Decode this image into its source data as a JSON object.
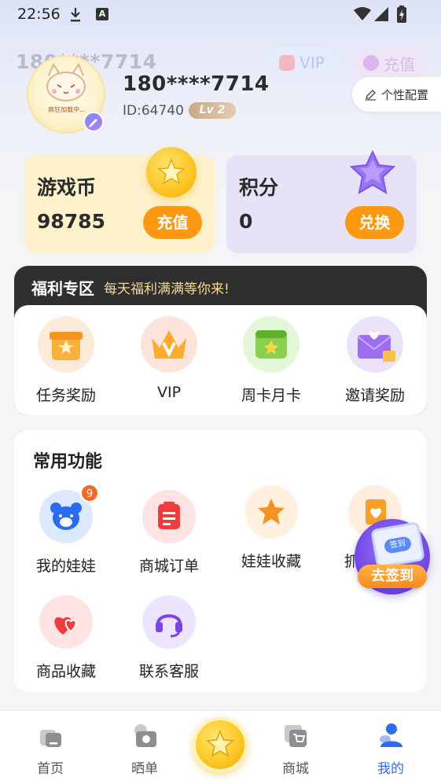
{
  "status_bar": {
    "time": "22:56"
  },
  "header": {
    "ghost_phone": "180****7714",
    "vip_label": "VIP",
    "recharge_label": "充值",
    "avatar_caption": "疯狂加载中...",
    "phone": "180****7714",
    "user_id": "ID:64740",
    "level": "Lv 2",
    "config_label": "个性配置"
  },
  "wallet": {
    "coins": {
      "title": "游戏币",
      "value": "98785",
      "button": "充值"
    },
    "points": {
      "title": "积分",
      "value": "0",
      "button": "兑换"
    }
  },
  "welfare": {
    "title": "福利专区",
    "subtitle": "每天福利满满等你来!",
    "items": [
      {
        "label": "任务奖励",
        "icon": "gift-box-icon"
      },
      {
        "label": "VIP",
        "icon": "crown-icon"
      },
      {
        "label": "周卡月卡",
        "icon": "calendar-card-icon"
      },
      {
        "label": "邀请奖励",
        "icon": "invite-envelope-icon"
      }
    ]
  },
  "common": {
    "title": "常用功能",
    "items": [
      {
        "label": "我的娃娃",
        "icon": "bear-icon",
        "badge": "9"
      },
      {
        "label": "商城订单",
        "icon": "order-icon"
      },
      {
        "label": "娃娃收藏",
        "icon": "star-icon"
      },
      {
        "label": "抓",
        "icon": "heart-card-icon"
      },
      {
        "label": "商品收藏",
        "icon": "hearts-icon"
      },
      {
        "label": "联系客服",
        "icon": "headset-icon"
      }
    ]
  },
  "floating_signin": {
    "label": "去签到",
    "calendar_text": "签到"
  },
  "bottom_nav": {
    "items": [
      {
        "label": "首页",
        "icon": "home-icon"
      },
      {
        "label": "晒单",
        "icon": "camera-icon"
      },
      {
        "label": "商城",
        "icon": "cart-icon"
      },
      {
        "label": "我的",
        "icon": "profile-icon",
        "active": true
      }
    ]
  },
  "colors": {
    "accent_orange": "#fb9a12",
    "active_blue": "#2f6bf0",
    "coin_card": "#fdf1cc",
    "points_card": "#e8e2f9"
  }
}
